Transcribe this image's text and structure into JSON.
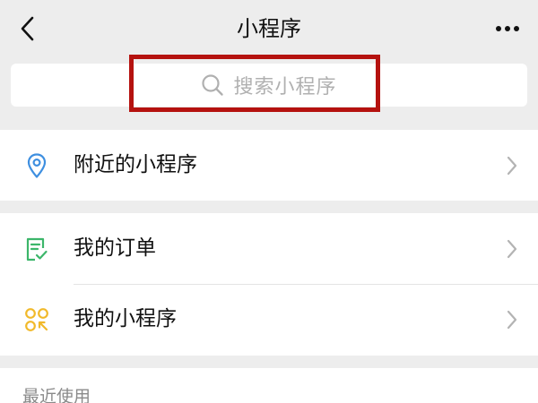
{
  "nav": {
    "title": "小程序"
  },
  "search": {
    "placeholder": "搜索小程序"
  },
  "groups": [
    {
      "items": [
        {
          "label": "附近的小程序",
          "icon": "location-pin-icon",
          "color": "#3e8fe0"
        }
      ]
    },
    {
      "items": [
        {
          "label": "我的订单",
          "icon": "order-checklist-icon",
          "color": "#3cb66a"
        },
        {
          "label": "我的小程序",
          "icon": "my-miniprograms-icon",
          "color": "#f1b92a"
        }
      ]
    }
  ],
  "recent": {
    "label": "最近使用"
  },
  "colors": {
    "highlight_border": "#b5120f",
    "background": "#ededed",
    "placeholder": "#b0b0b0"
  }
}
